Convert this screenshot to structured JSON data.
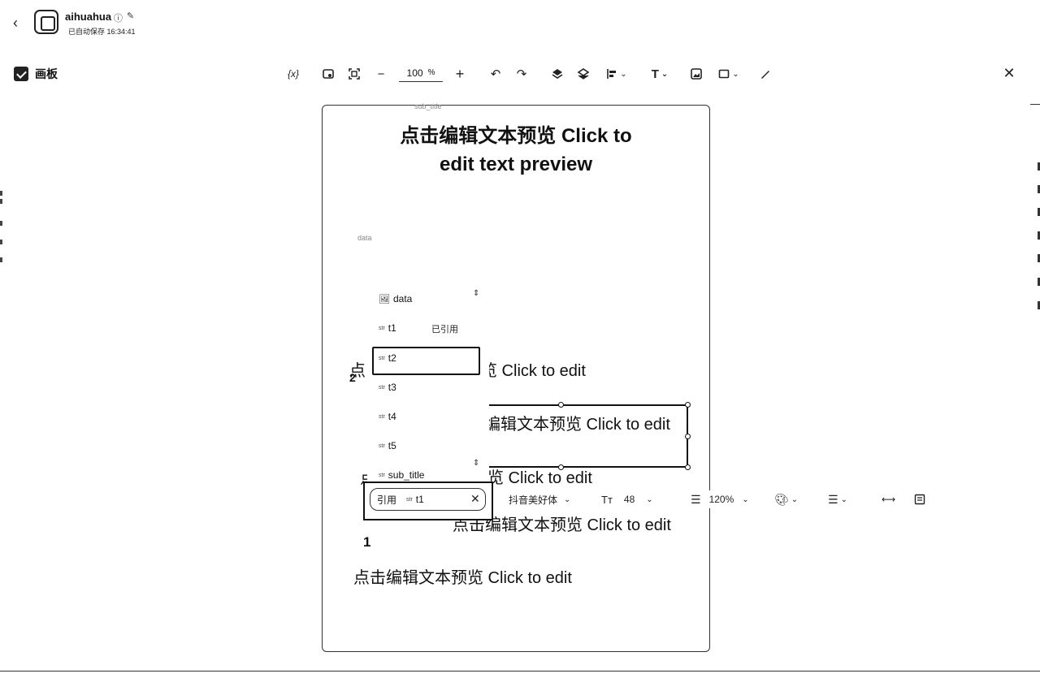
{
  "header": {
    "app_name": "aihuahua",
    "autosave": "已自动保存 16:34:41"
  },
  "panel": {
    "title": "画板"
  },
  "toolbar": {
    "variable_label": "{x}",
    "zoom_value": "100",
    "zoom_unit": "%"
  },
  "canvas": {
    "title_line1": "点击编辑文本预览 Click to",
    "title_line2": "edit text preview",
    "faint_top": "sub_title",
    "faint_data": "data",
    "texts": [
      "点",
      "览 Click to edit",
      "编辑文本预览 Click to edit",
      "点",
      "览 Click to edit",
      "点击编辑文本预览 Click to edit",
      "点击编辑文本预览 Click to edit"
    ],
    "number_2": "2",
    "number_1": "1"
  },
  "variables": {
    "items": [
      {
        "type": "",
        "name": "data"
      },
      {
        "type": "str",
        "name": "t1"
      },
      {
        "type": "str",
        "name": "t2"
      },
      {
        "type": "str",
        "name": "t3"
      },
      {
        "type": "str",
        "name": "t4"
      },
      {
        "type": "str",
        "name": "t5"
      },
      {
        "type": "str",
        "name": "sub_title"
      }
    ],
    "used_tag": "已引用"
  },
  "reference": {
    "label": "引用",
    "type": "str",
    "name": "t1"
  },
  "format_bar": {
    "font": "抖音美好体",
    "size": "48",
    "line_height": "120%",
    "size_icon": "Tт"
  },
  "icons": [
    "back-icon",
    "info-icon",
    "edit-icon",
    "fit-icon",
    "fullscreen-icon",
    "minus-icon",
    "plus-icon",
    "undo-icon",
    "redo-icon",
    "layer-up-icon",
    "layer-down-icon",
    "align-icon",
    "text-icon",
    "image-icon",
    "shape-icon",
    "pen-icon",
    "close-icon"
  ]
}
